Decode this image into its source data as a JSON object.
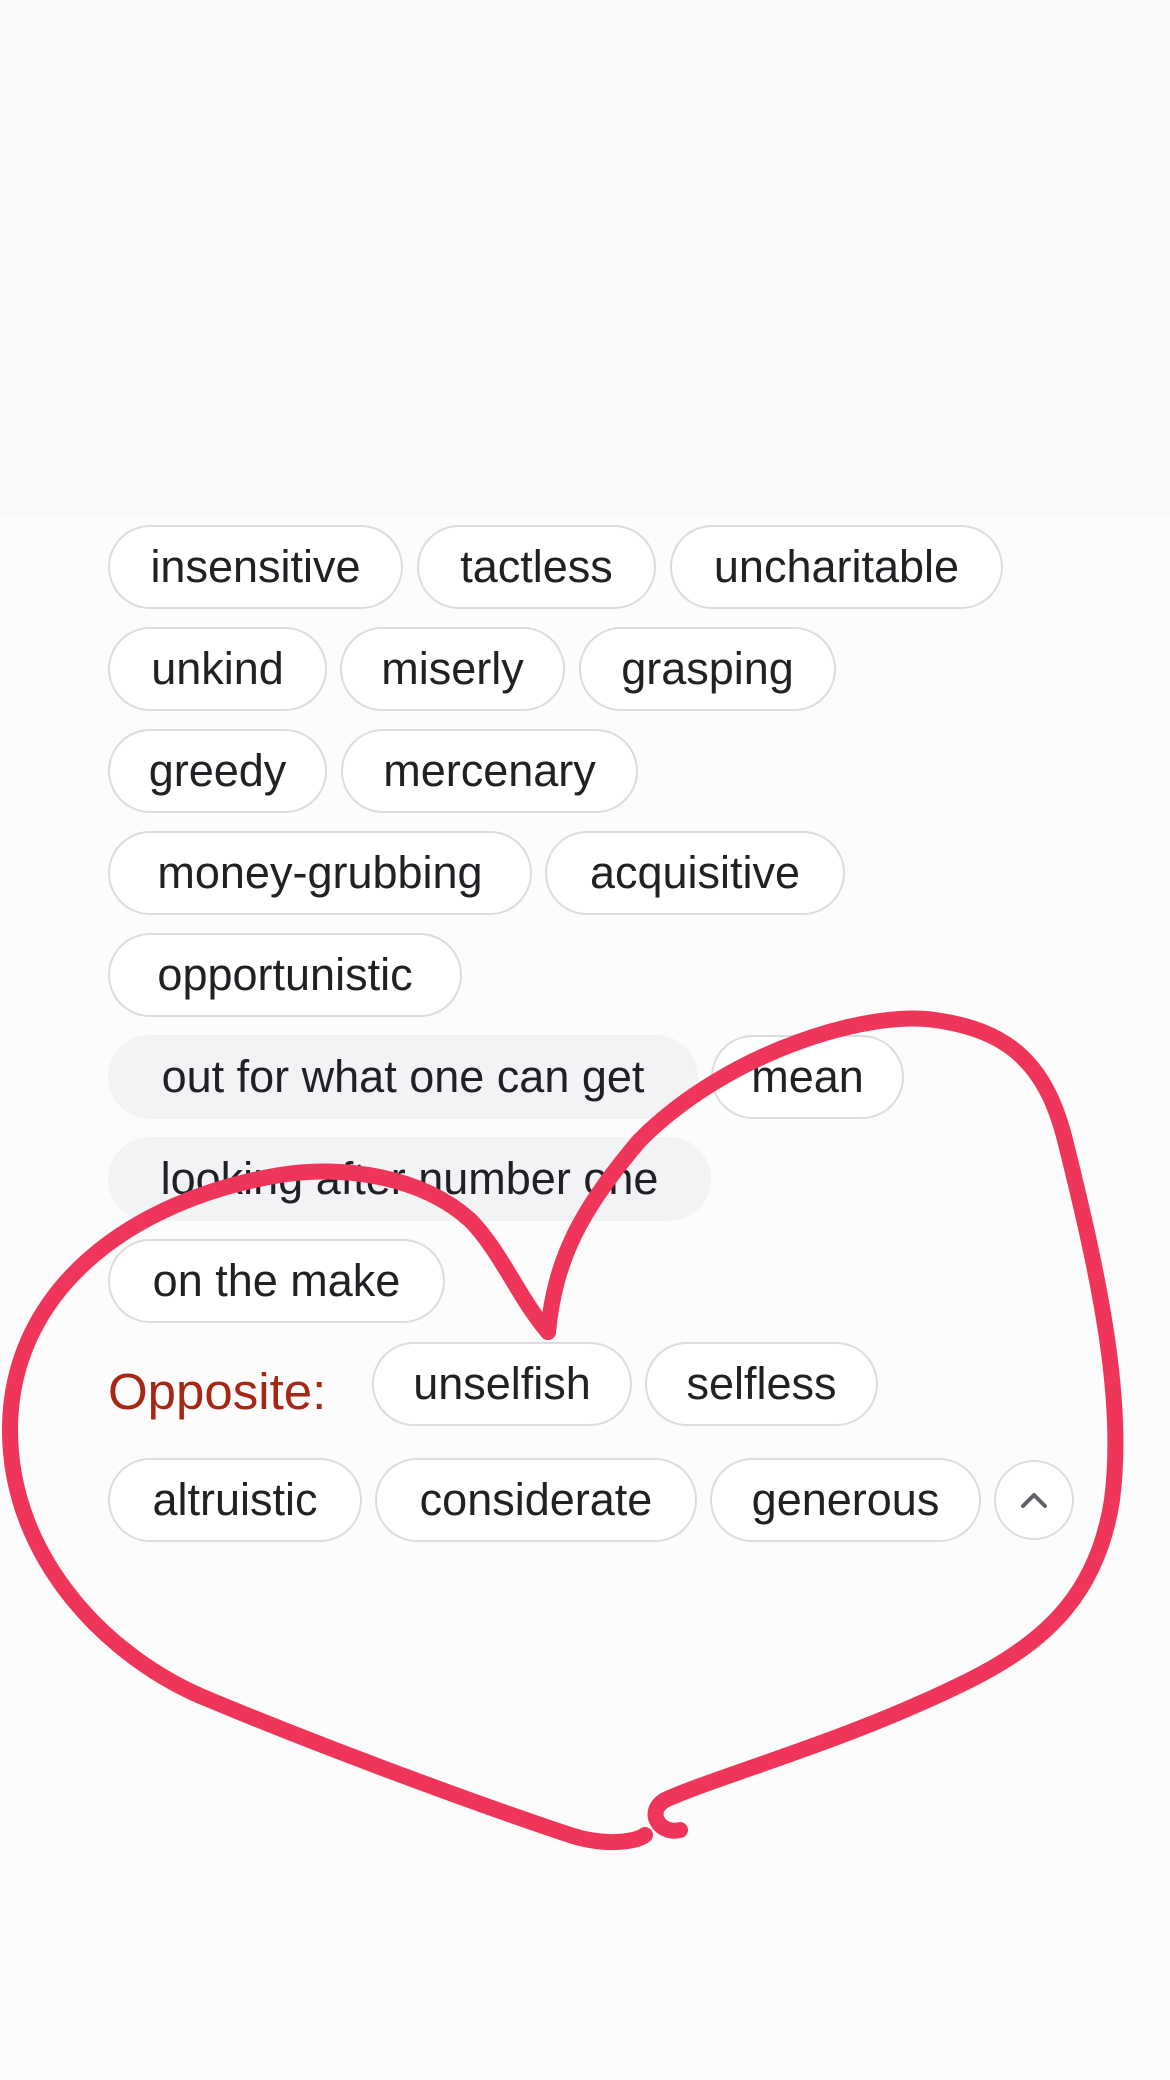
{
  "synonyms": {
    "row1": [
      "insensitive",
      "tactless",
      "uncharitable"
    ],
    "row2": [
      "unkind",
      "miserly",
      "grasping"
    ],
    "row3": [
      "greedy",
      "mercenary"
    ],
    "row4": [
      "money-grubbing",
      "acquisitive"
    ],
    "row5": [
      "opportunistic"
    ],
    "row6": [
      "out for what one can get",
      "mean"
    ],
    "row7": [
      "looking after number one"
    ],
    "row8": [
      "on the make"
    ]
  },
  "antonyms": {
    "label": "Opposite:",
    "row1": [
      "unselfish",
      "selfless"
    ],
    "row2": [
      "altruistic",
      "considerate",
      "generous"
    ]
  },
  "icons": {
    "collapse": "chevron-up-icon"
  },
  "colors": {
    "opposite_label": "#a52714",
    "chip_border": "#dadce0",
    "chip_fill": "#f1f3f4",
    "annotation": "#f0355a"
  }
}
